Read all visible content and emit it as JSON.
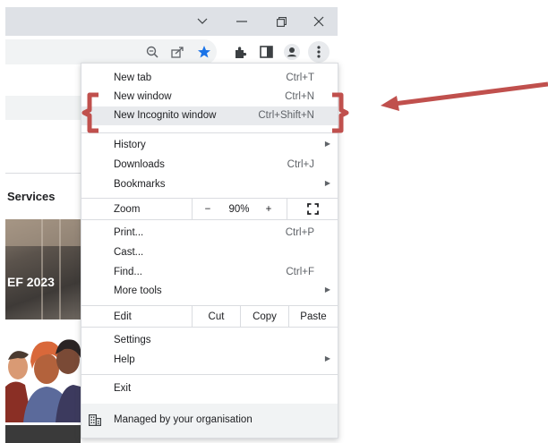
{
  "window": {
    "minimize_icon": "minimize-icon",
    "maximize_icon": "restore-icon",
    "close_icon": "close-icon",
    "dropdown_icon": "chevron-down-icon"
  },
  "toolbar": {
    "icons": [
      "zoom-icon",
      "share-icon",
      "star-icon",
      "extensions-icon",
      "side-panel-icon",
      "profile-icon",
      "kebab-menu-icon"
    ],
    "star_color": "#1a73e8"
  },
  "page": {
    "services_label": "Services",
    "photo_caption": "EF 2023"
  },
  "menu": {
    "new_tab": {
      "label": "New tab",
      "shortcut": "Ctrl+T"
    },
    "new_window": {
      "label": "New window",
      "shortcut": "Ctrl+N"
    },
    "new_incognito": {
      "label": "New Incognito window",
      "shortcut": "Ctrl+Shift+N"
    },
    "history": {
      "label": "History"
    },
    "downloads": {
      "label": "Downloads",
      "shortcut": "Ctrl+J"
    },
    "bookmarks": {
      "label": "Bookmarks"
    },
    "zoom": {
      "label": "Zoom",
      "minus": "−",
      "level": "90%",
      "plus": "+"
    },
    "print": {
      "label": "Print...",
      "shortcut": "Ctrl+P"
    },
    "cast": {
      "label": "Cast..."
    },
    "find": {
      "label": "Find...",
      "shortcut": "Ctrl+F"
    },
    "more_tools": {
      "label": "More tools"
    },
    "edit": {
      "label": "Edit",
      "cut": "Cut",
      "copy": "Copy",
      "paste": "Paste"
    },
    "settings": {
      "label": "Settings"
    },
    "help": {
      "label": "Help"
    },
    "exit": {
      "label": "Exit"
    },
    "managed": {
      "label": "Managed by your organisation"
    }
  },
  "annotation": {
    "color": "#c0504d"
  }
}
